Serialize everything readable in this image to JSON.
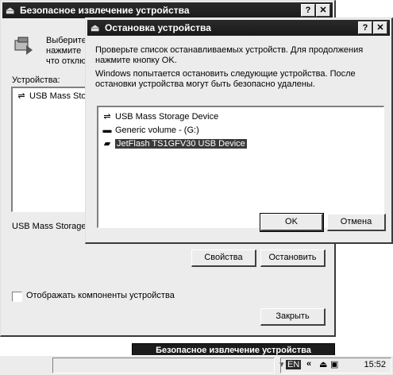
{
  "background_window": {
    "title": "Безопасное извлечение устройства",
    "help_btn": "?",
    "close_btn": "✕",
    "intro_line1": "Выберите",
    "intro_line2": "нажмите",
    "intro_line3": "что отклю",
    "devices_label": "Устройства:",
    "device_item": "USB Mass Stor",
    "status_text": "USB Mass Storage",
    "properties_btn": "Свойства",
    "stop_btn": "Остановить",
    "show_components_label": "Отображать компоненты устройства",
    "close_dialog_btn": "Закрыть"
  },
  "dialog": {
    "title": "Остановка устройства",
    "help_btn": "?",
    "close_btn": "✕",
    "instruction_line1": "Проверьте список останавливаемых устройств. Для продолжения",
    "instruction_line2": "нажмите кнопку OK.",
    "info_line1": "Windows попытается остановить следующие устройства. После",
    "info_line2": "остановки устройства могут быть безопасно удалены.",
    "devices": [
      {
        "label": "USB Mass Storage Device",
        "icon": "usb-icon"
      },
      {
        "label": "Generic volume - (G:)",
        "icon": "volume-icon"
      },
      {
        "label": "JetFlash TS1GFV30 USB Device",
        "icon": "flash-drive-icon"
      }
    ],
    "ok_btn": "OK",
    "cancel_btn": "Отмена"
  },
  "taskbar": {
    "tooltip": "Безопасное извлечение устройства",
    "lang": "EN",
    "chevron": "«",
    "clock": "15:52"
  }
}
